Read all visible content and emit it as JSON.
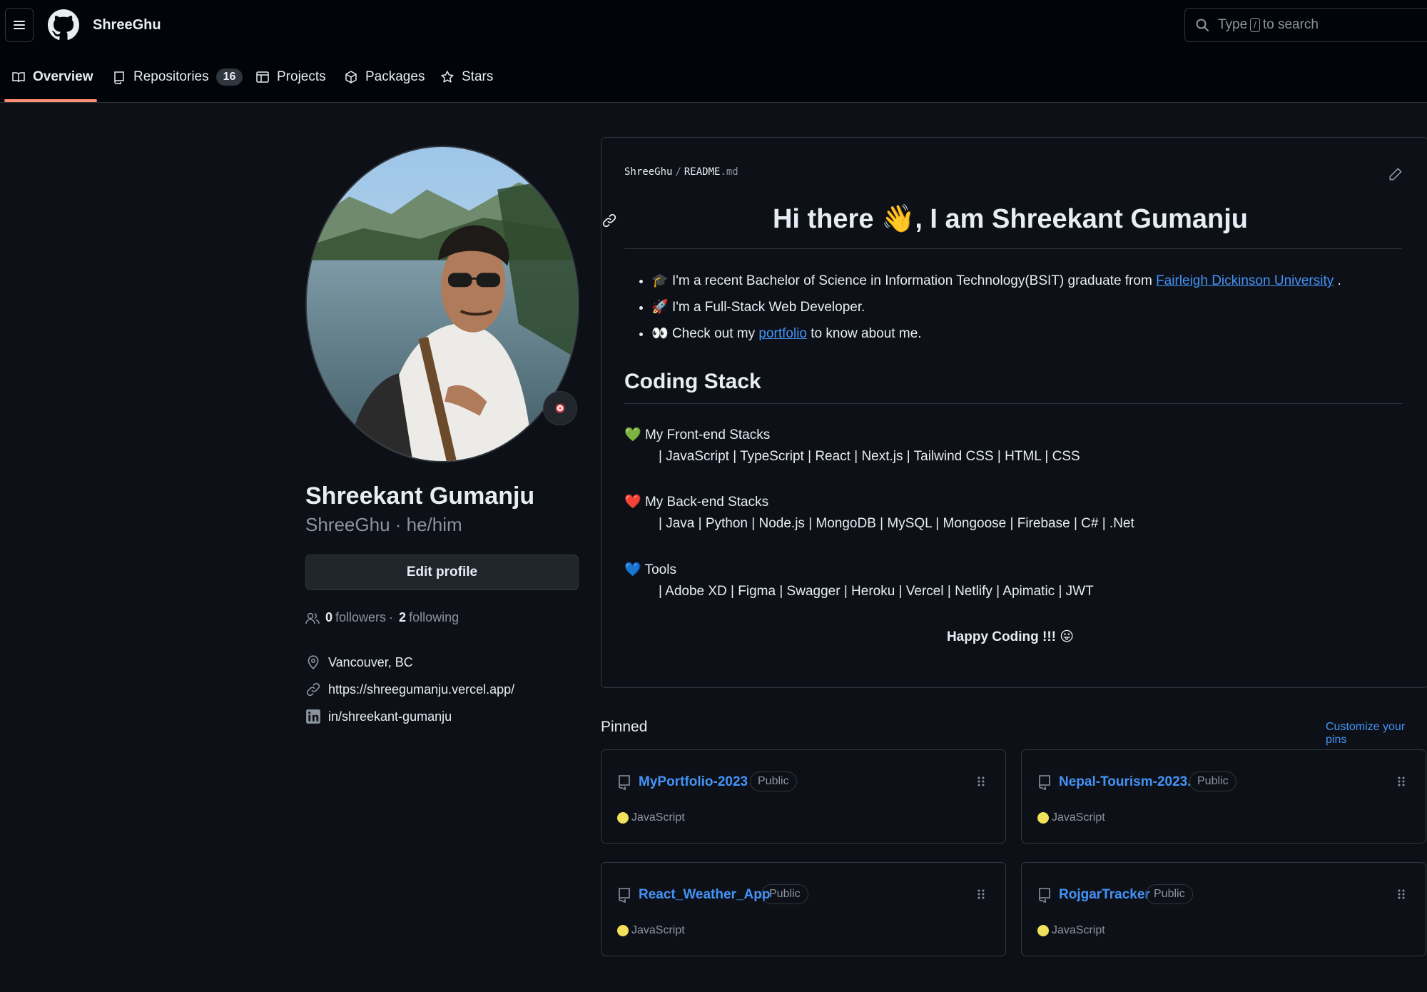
{
  "header": {
    "username": "ShreeGhu",
    "search": {
      "prefix": "Type",
      "key": "/",
      "suffix": "to search"
    }
  },
  "tabs": [
    {
      "label": "Overview",
      "icon": "book-icon",
      "active": true
    },
    {
      "label": "Repositories",
      "icon": "repo-icon",
      "count": "16"
    },
    {
      "label": "Projects",
      "icon": "table-icon"
    },
    {
      "label": "Packages",
      "icon": "package-icon"
    },
    {
      "label": "Stars",
      "icon": "star-icon"
    }
  ],
  "profile": {
    "name": "Shreekant Gumanju",
    "handle": "ShreeGhu · he/him",
    "edit_label": "Edit profile",
    "followers_count": "0",
    "followers_label": "followers",
    "separator": "·",
    "following_count": "2",
    "following_label": "following",
    "location": "Vancouver, BC",
    "website": "https://shreegumanju.vercel.app/",
    "linkedin": "in/shreekant-gumanju"
  },
  "readme": {
    "owner": "ShreeGhu",
    "file": "README",
    "ext": ".md",
    "heading": "Hi there 👋, I am Shreekant Gumanju",
    "bullets": [
      {
        "emoji": "🎓",
        "text": "I'm a recent Bachelor of Science in Information Technology(BSIT) graduate from ",
        "link": "Fairleigh Dickinson University",
        "after": " ."
      },
      {
        "emoji": "🚀",
        "text": "I'm a Full-Stack Web Developer."
      },
      {
        "emoji": "👀",
        "text": "Check out my ",
        "link": "portfolio",
        "after": " to know about me."
      }
    ],
    "section_title": "Coding Stack",
    "stacks": [
      {
        "emoji": "💚",
        "title": "My Front-end Stacks",
        "items": "| JavaScript | TypeScript | React | Next.js | Tailwind CSS | HTML | CSS"
      },
      {
        "emoji": "❤️",
        "title": "My Back-end Stacks",
        "items": "| Java | Python | Node.js | MongoDB | MySQL | Mongoose | Firebase | C# | .Net"
      },
      {
        "emoji": "💙",
        "title": "Tools",
        "items": "| Adobe XD | Figma | Swagger | Heroku | Vercel | Netlify | Apimatic | JWT"
      }
    ],
    "footer": "Happy Coding !!! 😛"
  },
  "pinned": {
    "title": "Pinned",
    "customize_label": "Customize your pins",
    "repos": [
      {
        "name": "MyPortfolio-2023",
        "visibility": "Public",
        "language": "JavaScript"
      },
      {
        "name": "Nepal-Tourism-2023.",
        "visibility": "Public",
        "language": "JavaScript"
      },
      {
        "name": "React_Weather_App",
        "visibility": "Public",
        "language": "JavaScript"
      },
      {
        "name": "RojgarTracker",
        "visibility": "Public",
        "language": "JavaScript"
      }
    ]
  },
  "colors": {
    "background": "#0d1117",
    "header": "#010409",
    "border": "#30363d",
    "link": "#4493f8",
    "muted": "#8b949e",
    "tab_underline": "#fd8c73",
    "javascript": "#f1e05a"
  }
}
